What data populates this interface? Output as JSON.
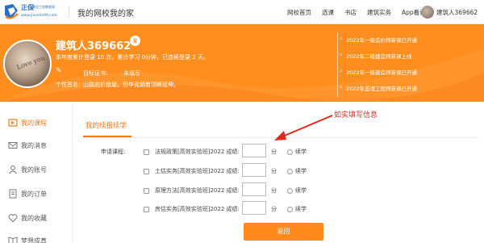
{
  "header": {
    "logo_cn": "正保",
    "logo_sub": "建设工程教育网",
    "logo_url": "www.jianshe99.com",
    "page_title": "我的网校我的家",
    "nav": [
      "网校首页",
      "选课",
      "书店",
      "建筑实务",
      "App看课"
    ],
    "username": "建筑人369662"
  },
  "banner": {
    "name": "建筑人369662",
    "stats": "本年度累计登录 10 次，累计学习 0分钟，已连续登录 2 天。",
    "cert_label": "目标证书:",
    "cert_value": "未填写",
    "signature_label": "个性签名:",
    "signature_value": "山路曲折盘旋，但毕竟朝着顶峰延伸。",
    "news": [
      "2022年一级造价师新课已开通",
      "2022年二级建造师新课上线",
      "2022年一级建造师新课已开通",
      "2022年监理工程师新课已开通"
    ]
  },
  "sidebar": {
    "items": [
      {
        "label": "我的课程",
        "icon": "course-icon",
        "active": true
      },
      {
        "label": "我的消息",
        "icon": "message-icon",
        "active": false
      },
      {
        "label": "我的账号",
        "icon": "user-icon",
        "active": false
      },
      {
        "label": "我的订单",
        "icon": "order-icon",
        "active": false
      },
      {
        "label": "我的收藏",
        "icon": "heart-icon",
        "active": false
      },
      {
        "label": "梦想成真",
        "icon": "book-icon",
        "active": false
      }
    ]
  },
  "main": {
    "tab": "我的续报续学",
    "annotation": "如实填写信息",
    "apply_label": "申请课程:",
    "rows": [
      {
        "text": "法规政策[高效实验班]2022 成绩:",
        "unit": "分",
        "option": "续学"
      },
      {
        "text": "土估实务[高效实验班]2022 成绩:",
        "unit": "分",
        "option": "续学"
      },
      {
        "text": "原理方法[高效实验班]2022 成绩:",
        "unit": "分",
        "option": "续学"
      },
      {
        "text": "房估实务[高效实验班]2022 成绩:",
        "unit": "分",
        "option": "续学"
      }
    ],
    "back_button": "返回"
  },
  "colors": {
    "accent": "#ff8e1f",
    "active": "#f07a13",
    "annotation": "#e12a1e",
    "brand_blue": "#2c6fbd"
  }
}
